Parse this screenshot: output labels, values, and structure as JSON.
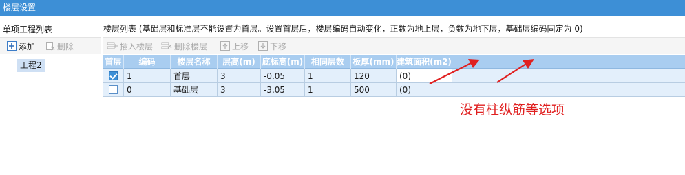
{
  "window": {
    "title": "楼层设置"
  },
  "left_panel": {
    "header": "单项工程列表",
    "toolbar": {
      "add_label": "添加",
      "delete_label": "删除"
    },
    "items": [
      {
        "label": "工程2",
        "selected": true
      }
    ]
  },
  "right_panel": {
    "header": "楼层列表 (基础层和标准层不能设置为首层。设置首层后，楼层编码自动变化，正数为地上层，负数为地下层，基础层编码固定为 0)",
    "toolbar": {
      "insert_label": "插入楼层",
      "delete_label": "删除楼层",
      "up_label": "上移",
      "down_label": "下移"
    }
  },
  "grid": {
    "columns": [
      "首层",
      "编码",
      "楼层名称",
      "层高(m)",
      "底标高(m)",
      "相同层数",
      "板厚(mm)",
      "建筑面积(m2)"
    ],
    "rows": [
      {
        "first_floor": true,
        "code": "1",
        "name": "首层",
        "height": "3",
        "bottom_elevation": "-0.05",
        "same_count": "1",
        "slab_thickness": "120",
        "area": "(0)"
      },
      {
        "first_floor": false,
        "code": "0",
        "name": "基础层",
        "height": "3",
        "bottom_elevation": "-3.05",
        "same_count": "1",
        "slab_thickness": "500",
        "area": "(0)"
      }
    ]
  },
  "annotation": {
    "text": "没有柱纵筋等选项",
    "color": "#e02020"
  },
  "colors": {
    "title_bar": "#3d8fd6",
    "grid_header": "#a9cdf0",
    "row_bg": "#e3effb",
    "selected_item": "#cfe0f4"
  }
}
